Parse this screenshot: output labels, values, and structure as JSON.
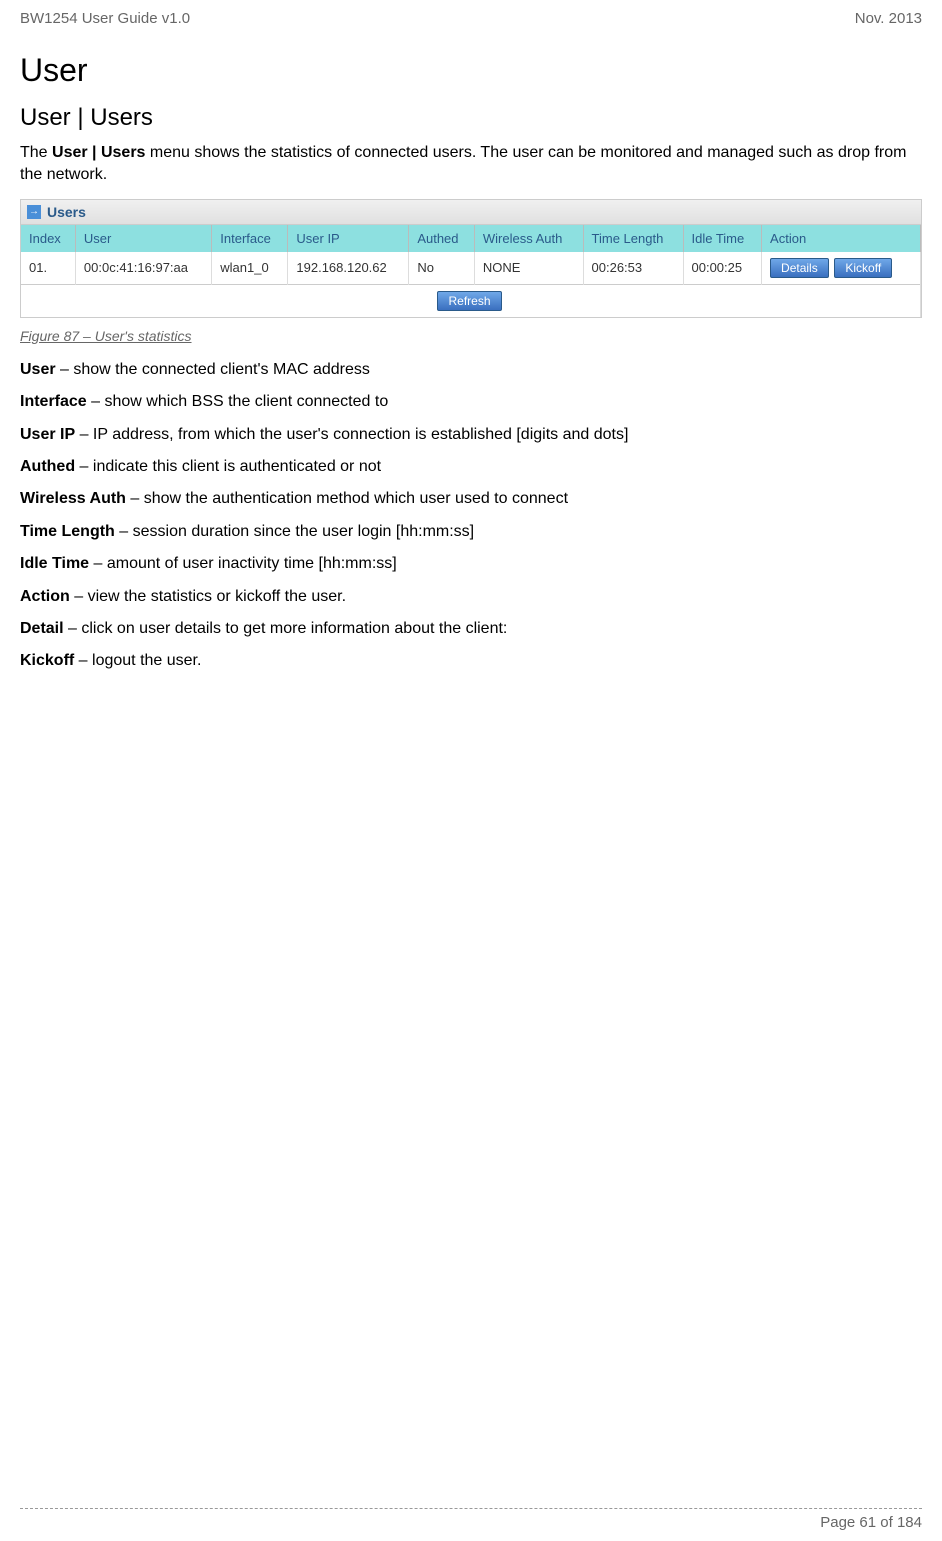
{
  "header": {
    "left": "BW1254 User Guide v1.0",
    "right": "Nov.  2013"
  },
  "title": "User",
  "subtitle": "User | Users",
  "intro": {
    "part1": "The ",
    "bold": "User | Users",
    "part2": " menu shows the statistics of connected users. The user can be monitored and managed such as drop from the network."
  },
  "panel": {
    "title": "Users",
    "headers": [
      "Index",
      "User",
      "Interface",
      "User IP",
      "Authed",
      "Wireless Auth",
      "Time Length",
      "Idle Time",
      "Action"
    ],
    "row": {
      "index": "01.",
      "user": "00:0c:41:16:97:aa",
      "interface": "wlan1_0",
      "userip": "192.168.120.62",
      "authed": "No",
      "wauth": "NONE",
      "tlength": "00:26:53",
      "idle": "00:00:25"
    },
    "buttons": {
      "details": "Details",
      "kickoff": "Kickoff",
      "refresh": "Refresh"
    }
  },
  "figure_caption": "Figure 87 – User's statistics",
  "definitions": [
    {
      "term": "User",
      "desc": " – show the connected client's MAC address"
    },
    {
      "term": "Interface",
      "desc": " – show which BSS the client connected to"
    },
    {
      "term": "User IP",
      "desc": " – IP address, from which the user's connection is established [digits and dots]"
    },
    {
      "term": "Authed",
      "desc": " – indicate this client is authenticated or not"
    },
    {
      "term": "Wireless Auth",
      "desc": " – show the authentication method which user used to connect"
    },
    {
      "term": "Time Length",
      "desc": " – session duration since the user login [hh:mm:ss]"
    },
    {
      "term": "Idle Time",
      "desc": " – amount of user inactivity time [hh:mm:ss]"
    },
    {
      "term": "Action",
      "desc": " – view the statistics or kickoff the user."
    },
    {
      "term": "Detail",
      "desc": " – click on user details to get more information about the client:"
    },
    {
      "term": "Kickoff",
      "desc": " – logout the user."
    }
  ],
  "footer": {
    "page": "Page 61 of 184"
  }
}
